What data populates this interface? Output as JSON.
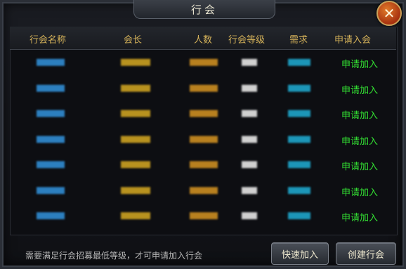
{
  "window": {
    "title": "行会",
    "close_glyph": "✕"
  },
  "table": {
    "headers": [
      "行会名称",
      "会长",
      "人数",
      "行会等级",
      "需求",
      "申请入会"
    ],
    "rows": [
      {
        "name_color": "#2c7fbf",
        "leader_color": "#b8921f",
        "count_color": "#b8801f",
        "level_color": "#d0d0d0",
        "req_color": "#1c96b8",
        "action": "申请加入"
      },
      {
        "name_color": "#2c7fbf",
        "leader_color": "#b8921f",
        "count_color": "#b8801f",
        "level_color": "#d0d0d0",
        "req_color": "#1c96b8",
        "action": "申请加入"
      },
      {
        "name_color": "#2c7fbf",
        "leader_color": "#b8921f",
        "count_color": "#b8801f",
        "level_color": "#d0d0d0",
        "req_color": "#1c96b8",
        "action": "申请加入"
      },
      {
        "name_color": "#2c7fbf",
        "leader_color": "#b8921f",
        "count_color": "#b8801f",
        "level_color": "#d0d0d0",
        "req_color": "#1c96b8",
        "action": "申请加入"
      },
      {
        "name_color": "#2c7fbf",
        "leader_color": "#b8921f",
        "count_color": "#b8801f",
        "level_color": "#d0d0d0",
        "req_color": "#1c96b8",
        "action": "申请加入"
      },
      {
        "name_color": "#2c7fbf",
        "leader_color": "#b8921f",
        "count_color": "#b8801f",
        "level_color": "#d0d0d0",
        "req_color": "#1c96b8",
        "action": "申请加入"
      },
      {
        "name_color": "#2c7fbf",
        "leader_color": "#b8921f",
        "count_color": "#b8801f",
        "level_color": "#d0d0d0",
        "req_color": "#1c96b8",
        "action": "申请加入"
      }
    ]
  },
  "footer": {
    "note": "需要满足行会招募最低等级，才可申请加入行会",
    "quick_join": "快速加入",
    "create_guild": "创建行会"
  }
}
